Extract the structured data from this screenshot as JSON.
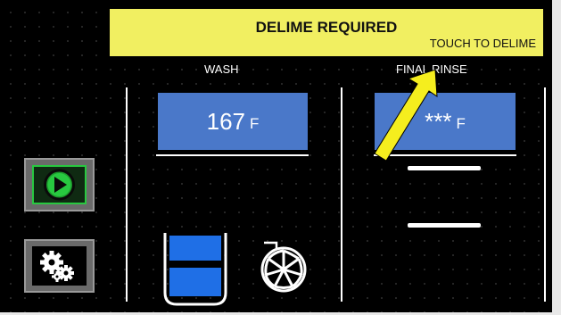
{
  "banner": {
    "title": "DELIME REQUIRED",
    "action": "TOUCH TO DELIME"
  },
  "wash": {
    "label": "WASH",
    "temp": "167",
    "unit": "F"
  },
  "final_rinse": {
    "label": "FINAL RINSE",
    "temp": "***",
    "unit": "F"
  },
  "colors": {
    "banner": "#f1ef61",
    "display": "#4a78c9",
    "arrow": "#f5ee1e",
    "start_green": "#28c840",
    "tank_water": "#1f6fe6"
  },
  "icons": [
    "start-play-icon",
    "settings-gears-icon",
    "tank-icon",
    "pump-fan-icon",
    "pointer-arrow-icon"
  ]
}
